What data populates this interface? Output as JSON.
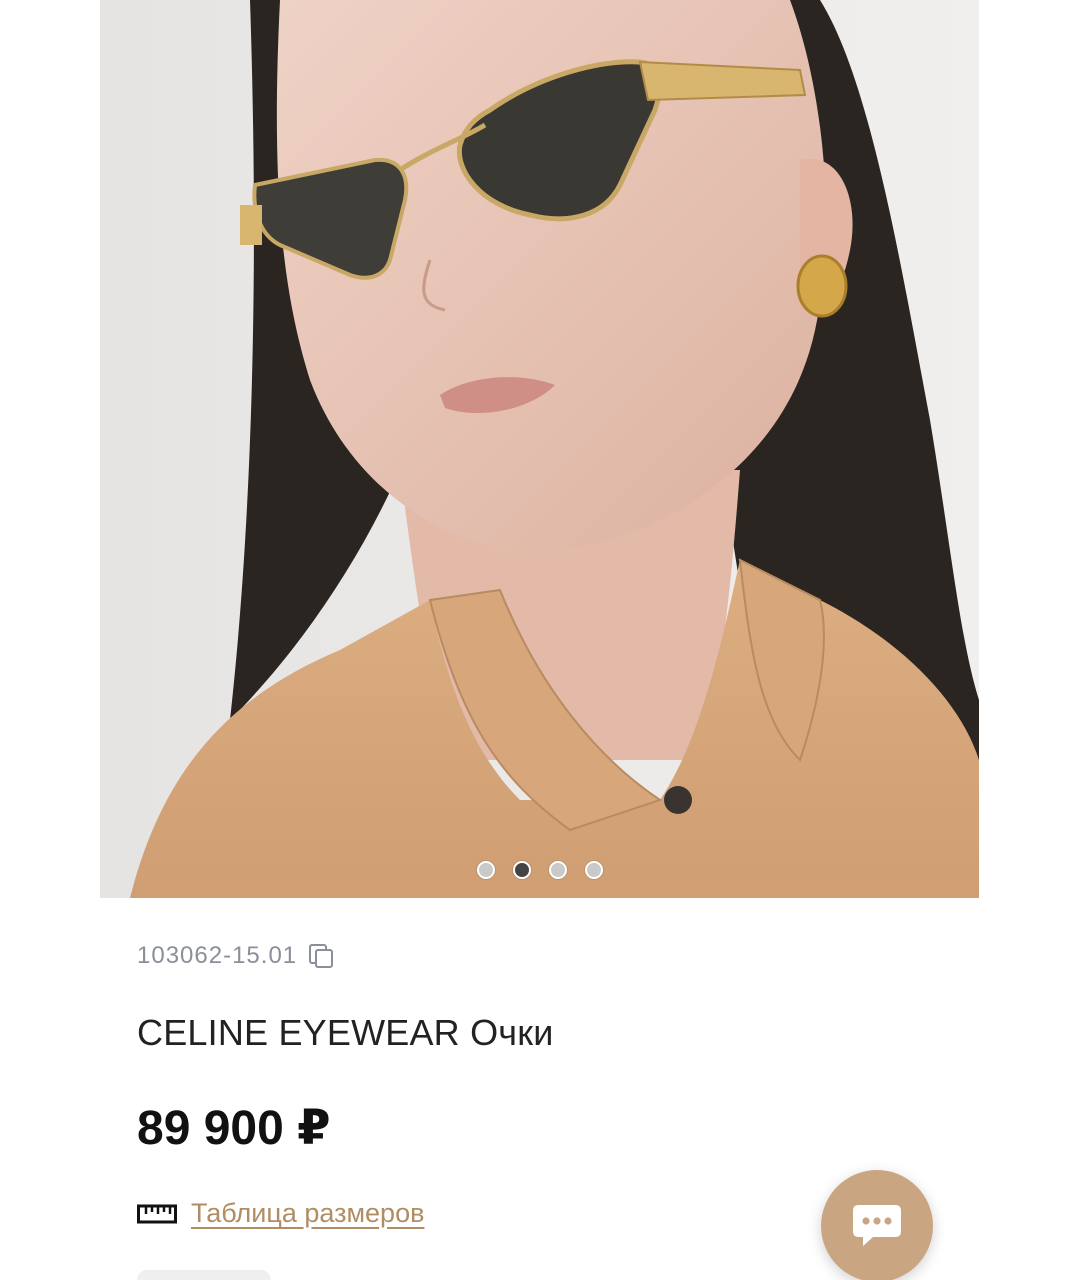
{
  "product": {
    "sku": "103062-15.01",
    "title": "CELINE EYEWEAR Очки",
    "price": "89 900 ₽",
    "size_table_label": "Таблица размеров"
  },
  "carousel": {
    "slide_count": 4,
    "active_index": 1
  },
  "colors": {
    "accent_link": "#b08d63",
    "chat_button": "#c9a681",
    "sku_text": "#8a8f99"
  },
  "icons": {
    "copy": "copy-icon",
    "ruler": "ruler-icon",
    "chat": "chat-bubble-icon"
  }
}
